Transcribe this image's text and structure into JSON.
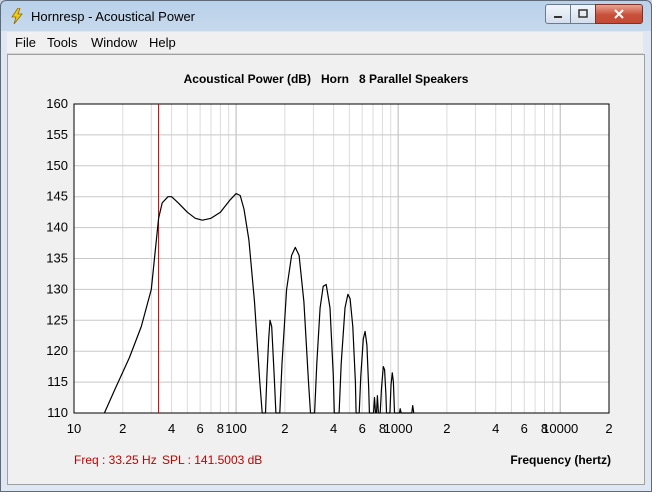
{
  "window": {
    "title": "Hornresp - Acoustical Power"
  },
  "menu": {
    "items": [
      "File",
      "Tools",
      "Window",
      "Help"
    ]
  },
  "chart_data": {
    "type": "line",
    "title": "Acoustical Power (dB)   Horn   8 Parallel Speakers",
    "xlabel": "Frequency (hertz)",
    "ylabel": "",
    "x_scale": "log",
    "xlim": [
      10,
      20000
    ],
    "ylim": [
      110,
      160
    ],
    "y_ticks": [
      160,
      155,
      150,
      145,
      140,
      135,
      130,
      125,
      120,
      115,
      110
    ],
    "x_tick_labels": [
      {
        "x": 10,
        "label": "10"
      },
      {
        "x": 20,
        "label": "2"
      },
      {
        "x": 40,
        "label": "4"
      },
      {
        "x": 60,
        "label": "6"
      },
      {
        "x": 80,
        "label": "8"
      },
      {
        "x": 100,
        "label": "100"
      },
      {
        "x": 200,
        "label": "2"
      },
      {
        "x": 400,
        "label": "4"
      },
      {
        "x": 600,
        "label": "6"
      },
      {
        "x": 800,
        "label": "8"
      },
      {
        "x": 1000,
        "label": "1000"
      },
      {
        "x": 2000,
        "label": "2"
      },
      {
        "x": 4000,
        "label": "4"
      },
      {
        "x": 6000,
        "label": "6"
      },
      {
        "x": 8000,
        "label": "8"
      },
      {
        "x": 10000,
        "label": "10000"
      },
      {
        "x": 20000,
        "label": "2"
      }
    ],
    "grid": true,
    "series": [
      {
        "color": "#000000",
        "points": [
          [
            15.4,
            110
          ],
          [
            18,
            114
          ],
          [
            22,
            119
          ],
          [
            26,
            124
          ],
          [
            30,
            130
          ],
          [
            33.25,
            141.5
          ],
          [
            35,
            144
          ],
          [
            38,
            145
          ],
          [
            40,
            145
          ],
          [
            44,
            144
          ],
          [
            50,
            142.5
          ],
          [
            56,
            141.5
          ],
          [
            62,
            141.2
          ],
          [
            70,
            141.5
          ],
          [
            80,
            142.5
          ],
          [
            92,
            144.5
          ],
          [
            100,
            145.5
          ],
          [
            106,
            145.2
          ],
          [
            112,
            143
          ],
          [
            120,
            138
          ],
          [
            130,
            128
          ],
          [
            140,
            115
          ],
          [
            145,
            110
          ],
          [
            152,
            110
          ],
          [
            155,
            116
          ],
          [
            159,
            122
          ],
          [
            162,
            125
          ],
          [
            166,
            124
          ],
          [
            172,
            116
          ],
          [
            176,
            110
          ],
          [
            186,
            110
          ],
          [
            192,
            118
          ],
          [
            205,
            130
          ],
          [
            220,
            135.5
          ],
          [
            232,
            136.8
          ],
          [
            245,
            135.5
          ],
          [
            262,
            128
          ],
          [
            280,
            115
          ],
          [
            288,
            110
          ],
          [
            305,
            110
          ],
          [
            315,
            118
          ],
          [
            330,
            127
          ],
          [
            345,
            130.5
          ],
          [
            360,
            130.8
          ],
          [
            380,
            127
          ],
          [
            398,
            116
          ],
          [
            404,
            110
          ],
          [
            432,
            110
          ],
          [
            445,
            118
          ],
          [
            470,
            127
          ],
          [
            490,
            129.2
          ],
          [
            505,
            128.5
          ],
          [
            525,
            124
          ],
          [
            545,
            115
          ],
          [
            550,
            110
          ],
          [
            575,
            110
          ],
          [
            588,
            116
          ],
          [
            610,
            122
          ],
          [
            625,
            123.2
          ],
          [
            642,
            121
          ],
          [
            658,
            114
          ],
          [
            665,
            110
          ],
          [
            705,
            110
          ],
          [
            715,
            112.5
          ],
          [
            725,
            110
          ],
          [
            735,
            110
          ],
          [
            745,
            112.8
          ],
          [
            755,
            110
          ],
          [
            775,
            110
          ],
          [
            790,
            114
          ],
          [
            810,
            117.5
          ],
          [
            825,
            117
          ],
          [
            840,
            113
          ],
          [
            848,
            110
          ],
          [
            890,
            110
          ],
          [
            903,
            114.5
          ],
          [
            920,
            116.5
          ],
          [
            935,
            115
          ],
          [
            950,
            110
          ],
          [
            1020,
            110
          ],
          [
            1030,
            110.7
          ],
          [
            1045,
            110
          ],
          [
            1215,
            110
          ],
          [
            1230,
            111.2
          ],
          [
            1250,
            110
          ]
        ]
      }
    ],
    "marker": {
      "x": 33.25,
      "color": "#cc0000"
    }
  },
  "status": {
    "freq": "Freq : 33.25 Hz",
    "spl": "SPL : 141.5003 dB"
  },
  "colors": {
    "grid": "#c8c8c8",
    "marker": "#cc0000",
    "status_text": "#c00000"
  }
}
